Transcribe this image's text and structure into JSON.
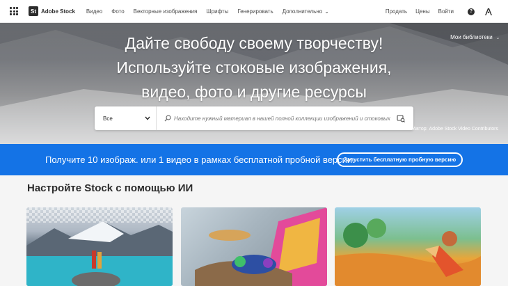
{
  "nav": {
    "logo_badge": "St",
    "logo_text": "Adobe Stock",
    "links": [
      "Видео",
      "Фото",
      "Векторные изображения",
      "Шрифты",
      "Генерировать",
      "Дополнительно"
    ],
    "right_links": [
      "Продать",
      "Цены",
      "Войти"
    ]
  },
  "hero": {
    "title_lines": [
      "Дайте свободу своему творчеству!",
      "Используйте стоковые изображения,",
      "видео, фото и другие ресурсы"
    ],
    "libraries": "Мои библиотеки",
    "credit": "Автор: Adobe Stock Video Contributors"
  },
  "search": {
    "category": "Все",
    "placeholder": "Находите нужный материал в нашей полной коллекции изображений и стоковых"
  },
  "promo": {
    "text": "Получите 10 изображ. или 1 видео в рамках бесплатной пробной версии.",
    "button": "Запустить бесплатную пробную версию"
  },
  "section": {
    "title": "Настройте Stock с помощью ИИ"
  },
  "colors": {
    "promo_blue": "#1473e6",
    "nav_text": "#4b4b4b"
  }
}
